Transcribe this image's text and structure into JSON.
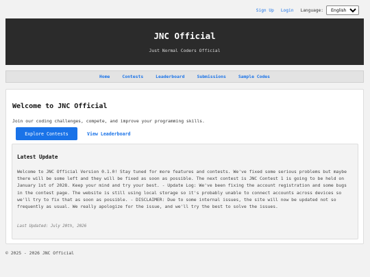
{
  "topbar": {
    "sign_up": "Sign Up",
    "login": "Login",
    "language_label": "Language:",
    "language_selected": "English"
  },
  "header": {
    "title": "JNC Official",
    "subtitle": "Just Normal Coders Official"
  },
  "nav": {
    "items": [
      {
        "label": "Home"
      },
      {
        "label": "Contests"
      },
      {
        "label": "Leaderboard"
      },
      {
        "label": "Submissions"
      },
      {
        "label": "Sample Codes"
      }
    ]
  },
  "main": {
    "heading": "Welcome to JNC Official",
    "intro": "Join our coding challenges, compete, and improve your programming skills.",
    "explore_button": "Explore Contests",
    "leaderboard_link": "View Leaderboard",
    "update": {
      "heading": "Latest Update",
      "body": "Welcome to JNC Official Version 0.1.0! Stay tuned for more features and contests. We've fixed some serious problems but maybe there will be some left and they will be fixed as soon as possible. The next contest is JNC Contest 1 is going to be held on January 1st of 2028. Keep your mind and try your best. - Update Log: We've been fixing the account registration and some bugs in the contest page. The website is still using local storage so it's probably unable to connect accounts across devices so we'll try to fix that as soon as possible. - DISCLAIMER: Due to some internal issues, the site will now be updated not so frequently as usual. We really apologize for the issue, and we'll try the best to solve the issues.",
      "last_updated": "Last Updated: July 20th, 2026"
    }
  },
  "footer": {
    "copyright": "© 2025 - 2026 JNC Official"
  },
  "colors": {
    "accent": "#1a73e8",
    "banner_bg": "#2b2b2b"
  }
}
